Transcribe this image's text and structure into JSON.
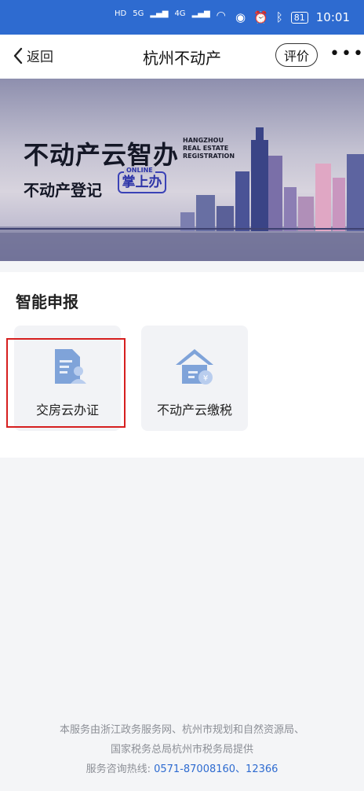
{
  "status_bar": {
    "time": "10:01",
    "battery": "81",
    "net_labels": [
      "5G",
      "4G"
    ]
  },
  "nav": {
    "back_label": "返回",
    "title": "杭州不动产",
    "rate_label": "评价",
    "more_label": "•••"
  },
  "banner": {
    "title": "不动产云智办",
    "en_line1": "HANGZHOU",
    "en_line2": "REAL ESTATE",
    "en_line3": "REGISTRATION",
    "subtitle": "不动产登记",
    "badge_online": "ONLINE",
    "badge_label": "掌上办"
  },
  "section": {
    "title": "智能申报",
    "services": [
      {
        "label": "交房云办证",
        "icon": "document-user-icon"
      },
      {
        "label": "不动产云缴税",
        "icon": "house-coin-icon"
      }
    ]
  },
  "footer": {
    "line1": "本服务由浙江政务服务网、杭州市规划和自然资源局、",
    "line2": "国家税务总局杭州市税务局提供",
    "hotline_label": "服务咨询热线:",
    "hotline_numbers": "0571-87008160、12366"
  },
  "colors": {
    "brand_blue": "#2e6bd0",
    "highlight_red": "#d61f1f"
  }
}
